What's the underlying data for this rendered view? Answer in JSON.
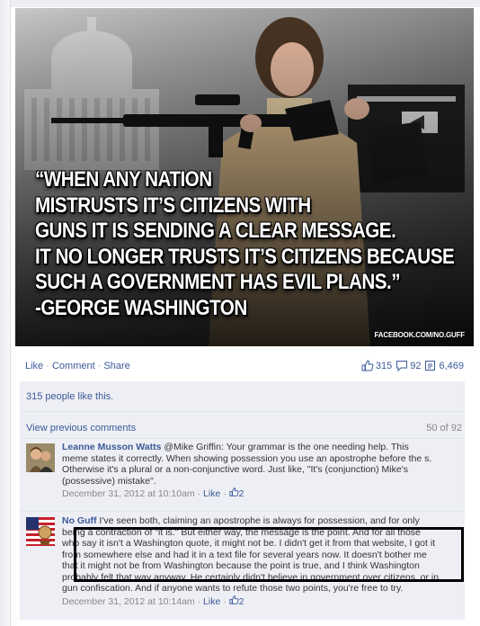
{
  "post": {
    "image": {
      "quote_lines": [
        "“WHEN ANY NATION",
        "MISTRUSTS IT’S CITIZENS WITH",
        "GUNS IT IS SENDING A CLEAR MESSAGE.",
        "IT NO LONGER TRUSTS IT’S CITIZENS BECAUSE",
        "SUCH A GOVERNMENT HAS EVIL PLANS.”",
        "-GEORGE WASHINGTON"
      ],
      "watermark": "FACEBOOK.COM/NO.GUFF"
    },
    "actions": {
      "like": "Like",
      "comment": "Comment",
      "share": "Share",
      "separator": "·"
    },
    "stats": {
      "likes": "315",
      "comments": "92",
      "shares": "6,469"
    },
    "likes_summary": "315 people like this.",
    "view_previous": "View previous comments",
    "comment_position": "50 of 92",
    "comments": [
      {
        "author": "Leanne Musson Watts",
        "text_lines": [
          "@Mike Griffin: Your grammar is the one needing help. This",
          "meme states it correctly. When showing possession you use an apostrophe before the s.",
          "Otherwise it's a plural or a non-conjunctive word. Just like, \"It's (conjunction) Mike's",
          "(possessive) mistake\"."
        ],
        "timestamp": "December 31, 2012 at 10:10am",
        "like_label": "Like",
        "like_count": "2"
      },
      {
        "author": "No Guff",
        "text_lines": [
          "I've seen both, claiming an apostrophe is always for possession, and for only",
          "being a contraction of \"it is.\" But either way, the message is the point. And for all those",
          "who say it isn't a Washington quote, it might not be. I didn't get it from that website, I got it",
          "from somewhere else and had it in a text file for several years now. It doesn't bother me",
          "that it might not be from Washington because the point is true, and I think Washington",
          "probably felt that way anyway. He certainly didn't believe in government over citizens, or in",
          "gun confiscation. And if anyone wants to refute those two points, you're free to try."
        ],
        "timestamp": "December 31, 2012 at 10:14am",
        "like_label": "Like",
        "like_count": "2"
      }
    ]
  },
  "colors": {
    "link": "#3b5998",
    "ufi_background": "#edeff4",
    "meta_text": "#888888"
  }
}
